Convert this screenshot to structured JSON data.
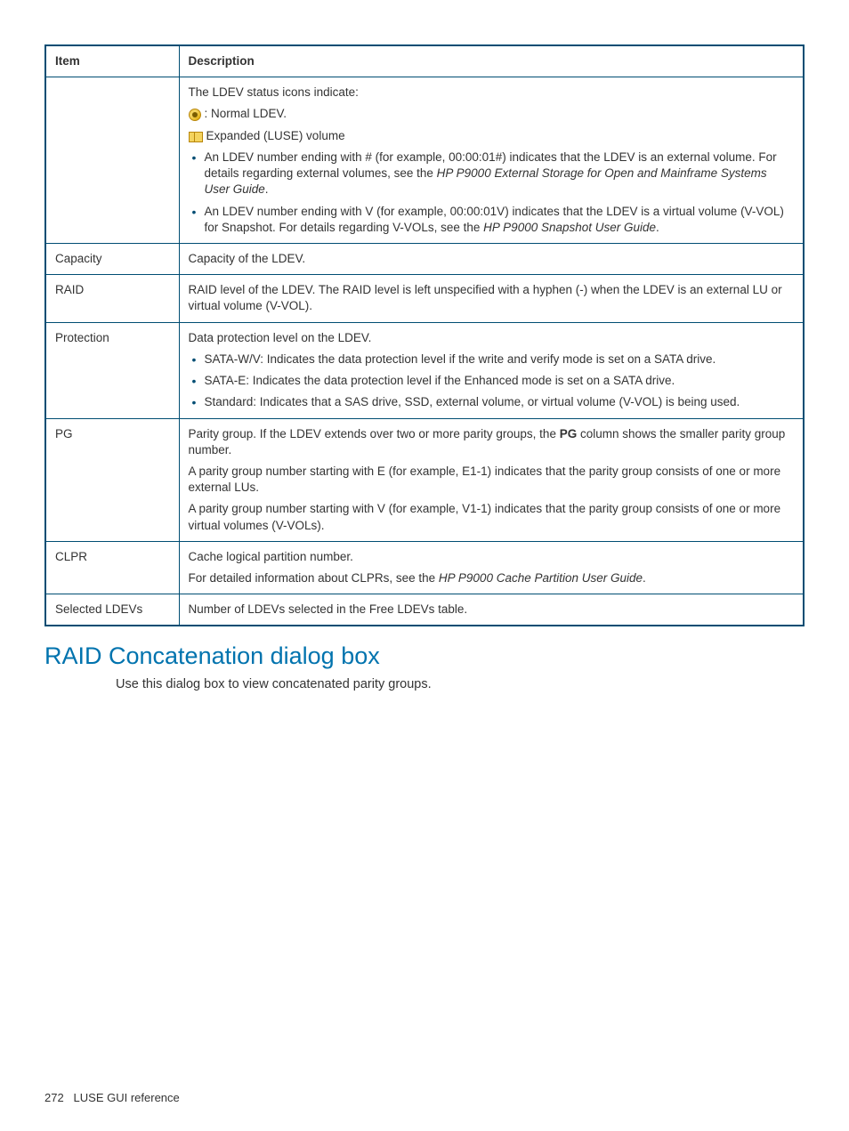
{
  "table": {
    "header_item": "Item",
    "header_desc": "Description",
    "row_ldev": {
      "intro": "The LDEV status icons indicate:",
      "normal": ": Normal LDEV.",
      "expanded": " Expanded (LUSE) volume",
      "bullet1_a": "An LDEV number ending with # (for example, 00:00:01#) indicates that the LDEV is an external volume. For details regarding external volumes, see the ",
      "bullet1_i": "HP P9000 External Storage for Open and Mainframe Systems User Guide",
      "bullet1_b": ".",
      "bullet2_a": "An LDEV number ending with V (for example, 00:00:01V) indicates that the LDEV is a virtual volume (V-VOL) for Snapshot. For details regarding V-VOLs, see the ",
      "bullet2_i": "HP P9000 Snapshot User Guide",
      "bullet2_b": "."
    },
    "row_capacity": {
      "item": "Capacity",
      "desc": "Capacity of the LDEV."
    },
    "row_raid": {
      "item": "RAID",
      "desc": "RAID level of the LDEV. The RAID level is left unspecified with a hyphen (-) when the LDEV is an external LU or virtual volume (V-VOL)."
    },
    "row_protection": {
      "item": "Protection",
      "intro": "Data protection level on the LDEV.",
      "b1": "SATA-W/V: Indicates the data protection level if the write and verify mode is set on a SATA drive.",
      "b2": "SATA-E: Indicates the data protection level if the Enhanced mode is set on a SATA drive.",
      "b3": "Standard: Indicates that a SAS drive, SSD, external volume, or virtual volume (V-VOL) is being used."
    },
    "row_pg": {
      "item": "PG",
      "p1_a": "Parity group. If the LDEV extends over two or more parity groups, the ",
      "p1_bold": "PG",
      "p1_b": " column shows the smaller parity group number.",
      "p2": "A parity group number starting with E (for example, E1-1) indicates that the parity group consists of one or more external LUs.",
      "p3": "A parity group number starting with V (for example, V1-1) indicates that the parity group consists of one or more virtual volumes (V-VOLs)."
    },
    "row_clpr": {
      "item": "CLPR",
      "p1": "Cache logical partition number.",
      "p2_a": "For detailed information about CLPRs, see the ",
      "p2_i": "HP P9000 Cache Partition User Guide",
      "p2_b": "."
    },
    "row_selected": {
      "item": "Selected LDEVs",
      "desc": "Number of LDEVs selected in the Free LDEVs table."
    }
  },
  "heading": "RAID Concatenation dialog box",
  "body": "Use this dialog box to view concatenated parity groups.",
  "footer_page": "272",
  "footer_title": "LUSE GUI reference"
}
